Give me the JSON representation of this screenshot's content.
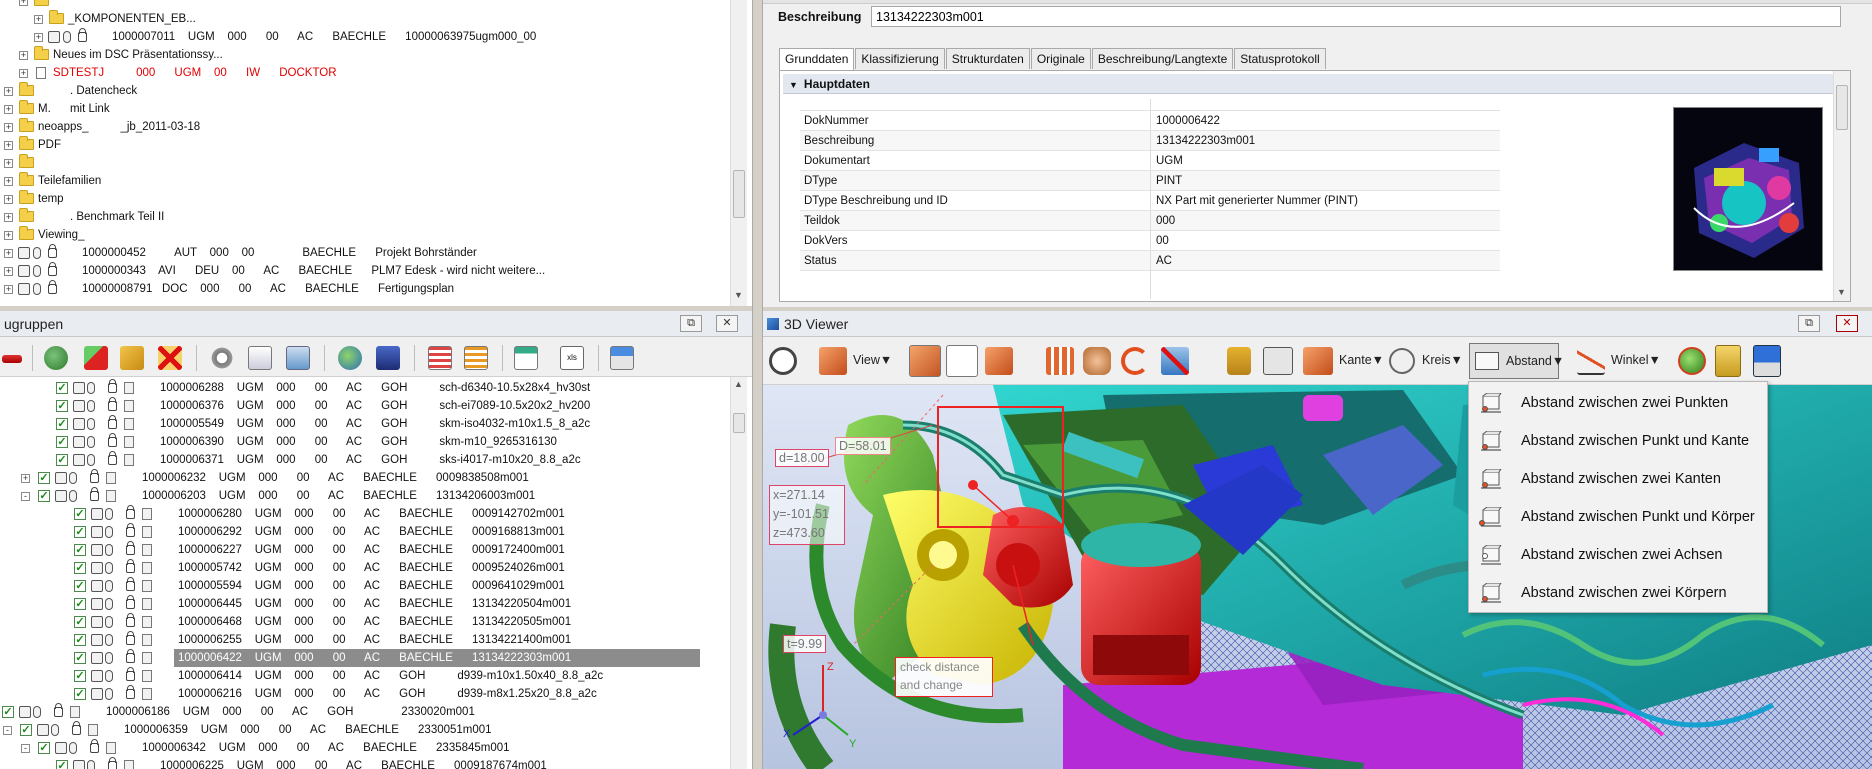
{
  "left_top_tree": {
    "rows": [
      {
        "indent": 1,
        "kind": "folder",
        "text": ""
      },
      {
        "indent": 2,
        "kind": "folder",
        "text": "_KOMPONENTEN_EB..."
      },
      {
        "indent": 2,
        "kind": "item",
        "text": "1000007011    UGM    000      00      AC      BAECHLE      10000063975ugm000_00"
      },
      {
        "indent": 1,
        "kind": "folder",
        "text": "Neues im DSC Präsentationssy..."
      },
      {
        "indent": 1,
        "kind": "doc",
        "text": "SDTESTJ          000      UGM    00      IW      DOCKTOR",
        "red": true
      },
      {
        "indent": 0,
        "kind": "folder",
        "text": "          . Datencheck"
      },
      {
        "indent": 0,
        "kind": "folder",
        "text": "M.      mit Link"
      },
      {
        "indent": 0,
        "kind": "folder",
        "text": "neoapps_          _jb_2011-03-18"
      },
      {
        "indent": 0,
        "kind": "folder",
        "text": "PDF"
      },
      {
        "indent": 0,
        "kind": "folder",
        "text": ""
      },
      {
        "indent": 0,
        "kind": "folder",
        "text": "Teilefamilien"
      },
      {
        "indent": 0,
        "kind": "folder",
        "text": "temp"
      },
      {
        "indent": 0,
        "kind": "folder",
        "text": "          . Benchmark Teil II"
      },
      {
        "indent": 0,
        "kind": "folder",
        "text": "Viewing_"
      },
      {
        "indent": 0,
        "kind": "item",
        "text": "1000000452         AUT    000    00               BAECHLE      Projekt Bohrständer"
      },
      {
        "indent": 0,
        "kind": "item2",
        "text": "1000000343    AVI      DEU    00      AC      BAECHLE      PLM7 Edesk - wird nicht weitere..."
      },
      {
        "indent": 0,
        "kind": "item2",
        "text": "10000008791   DOC    000      00      AC      BAECHLE      Fertigungsplan"
      }
    ]
  },
  "left_bottom": {
    "title": "ugruppen",
    "rows": [
      {
        "indent": 2,
        "text": "1000006288    UGM    000      00      AC      GOH          sch-d6340-10.5x28x4_hv30st"
      },
      {
        "indent": 2,
        "text": "1000006376    UGM    000      00      AC      GOH          sch-ei7089-10.5x20x2_hv200"
      },
      {
        "indent": 2,
        "text": "1000005549    UGM    000      00      AC      GOH          skm-iso4032-m10x1.5_8_a2c"
      },
      {
        "indent": 2,
        "text": "1000006390    UGM    000      00      AC      GOH          skm-m10_9265316130"
      },
      {
        "indent": 2,
        "text": "1000006371    UGM    000      00      AC      GOH          sks-i4017-m10x20_8.8_a2c"
      },
      {
        "indent": 1,
        "text": "1000006232    UGM    000      00      AC      BAECHLE      0009838508m001",
        "exp": "+"
      },
      {
        "indent": 1,
        "text": "1000006203    UGM    000      00      AC      BAECHLE      13134206003m001",
        "exp": "-"
      },
      {
        "indent": 3,
        "text": "1000006280    UGM    000      00      AC      BAECHLE      0009142702m001"
      },
      {
        "indent": 3,
        "text": "1000006292    UGM    000      00      AC      BAECHLE      0009168813m001"
      },
      {
        "indent": 3,
        "text": "1000006227    UGM    000      00      AC      BAECHLE      0009172400m001"
      },
      {
        "indent": 3,
        "text": "1000005742    UGM    000      00      AC      BAECHLE      0009524026m001"
      },
      {
        "indent": 3,
        "text": "1000005594    UGM    000      00      AC      BAECHLE      0009641029m001"
      },
      {
        "indent": 3,
        "text": "1000006445    UGM    000      00      AC      BAECHLE      13134220504m001"
      },
      {
        "indent": 3,
        "text": "1000006468    UGM    000      00      AC      BAECHLE      13134220505m001"
      },
      {
        "indent": 3,
        "text": "1000006255    UGM    000      00      AC      BAECHLE      13134221400m001"
      },
      {
        "indent": 3,
        "text": "1000006422    UGM    000      00      AC      BAECHLE      13134222303m001",
        "selected": true
      },
      {
        "indent": 3,
        "text": "1000006414    UGM    000      00      AC      GOH          d939-m10x1.50x40_8.8_a2c"
      },
      {
        "indent": 3,
        "text": "1000006216    UGM    000      00      AC      GOH          d939-m8x1.25x20_8.8_a2c"
      },
      {
        "indent": -1,
        "text": "1000006186    UGM    000      00      AC      GOH               2330020m001",
        "exp": "-"
      },
      {
        "indent": 0,
        "text": "1000006359    UGM    000      00      AC      BAECHLE      2330051m001",
        "exp": "-"
      },
      {
        "indent": 1,
        "text": "1000006342    UGM    000      00      AC      BAECHLE      2335845m001",
        "exp": "-"
      },
      {
        "indent": 2,
        "text": "1000006225    UGM    000      00      AC      BAECHLE      0009187674m001"
      }
    ]
  },
  "detail": {
    "beschreibung_label": "Beschreibung",
    "beschreibung_value": "13134222303m001",
    "tabs": [
      "Grunddaten",
      "Klassifizierung",
      "Strukturdaten",
      "Originale",
      "Beschreibung/Langtexte",
      "Statusprotokoll"
    ],
    "section": "Hauptdaten",
    "props": [
      {
        "k": "DokNummer",
        "v": "1000006422"
      },
      {
        "k": "Beschreibung",
        "v": "13134222303m001"
      },
      {
        "k": "Dokumentart",
        "v": "UGM"
      },
      {
        "k": "DType",
        "v": "PINT"
      },
      {
        "k": "DType Beschreibung und ID",
        "v": "NX Part mit generierter Nummer (PINT)"
      },
      {
        "k": "Teildok",
        "v": "000"
      },
      {
        "k": "DokVers",
        "v": "00"
      },
      {
        "k": "Status",
        "v": "AC"
      }
    ]
  },
  "viewer": {
    "title": "3D Viewer",
    "view_label": "View▼",
    "kante_label": "Kante▼",
    "kreis_label": "Kreis▼",
    "abstand_label": "Abstand▼",
    "winkel_label": "Winkel▼",
    "menu": [
      "Abstand zwischen zwei Punkten",
      "Abstand zwischen Punkt und Kante",
      "Abstand zwischen zwei Kanten",
      "Abstand zwischen Punkt und Körper",
      "Abstand zwischen zwei Achsen",
      "Abstand zwischen zwei Körpern"
    ],
    "annotations": {
      "D": "D=58.01",
      "d": "d=18.00",
      "x": "x=271.14",
      "y": "y=-101.51",
      "z": "z=473.60",
      "t": "t=9.99",
      "callout1": "check distance",
      "callout2": "and change"
    }
  }
}
